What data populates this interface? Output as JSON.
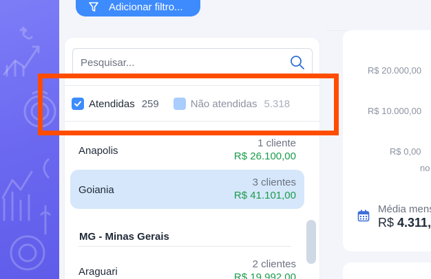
{
  "filter_button": {
    "label": "Adicionar filtro...",
    "icon": "filter-icon"
  },
  "search": {
    "placeholder": "Pesquisar...",
    "value": "",
    "icon": "search-icon"
  },
  "status_filter": {
    "attended": {
      "label": "Atendidas",
      "count": "259",
      "checked": true
    },
    "not_attended": {
      "label": "Não atendidas",
      "count": "5.318",
      "checked": false
    }
  },
  "cities": [
    {
      "name": "Anapolis",
      "count": "1 cliente",
      "value": "R$ 26.100,00",
      "selected": false
    },
    {
      "name": "Goiania",
      "count": "3 clientes",
      "value": "R$ 41.101,00",
      "selected": true
    },
    {
      "name": "Araguari",
      "count": "2 clientes",
      "value": "R$ 19.992,00",
      "selected": false
    }
  ],
  "state_group": {
    "label": "MG - Minas Gerais"
  },
  "chart": {
    "y_ticks": [
      "R$ 20.000,00",
      "R$ 10.000,00",
      "R$ 0,00"
    ],
    "legend_fragment": "no"
  },
  "average": {
    "label": "Média mens",
    "prefix": "R$ ",
    "value": "4.311,",
    "icon": "calendar-icon"
  },
  "colors": {
    "accent": "#3d8bfd",
    "selected_row": "#d6e7fb",
    "money": "#1a9b4b",
    "highlight": "#ff4d00",
    "sidebar": "#6a67f0"
  }
}
